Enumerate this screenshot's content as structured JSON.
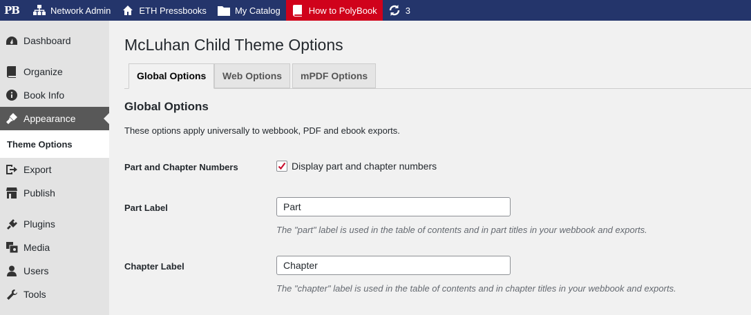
{
  "adminbar": {
    "logo": "PB",
    "items": [
      {
        "label": "Network Admin",
        "icon": "network-icon"
      },
      {
        "label": "ETH Pressbooks",
        "icon": "home-icon"
      },
      {
        "label": "My Catalog",
        "icon": "folder-icon"
      },
      {
        "label": "How to PolyBook",
        "icon": "book-icon"
      }
    ],
    "updates_count": "3",
    "colors": {
      "bar": "#24356b",
      "active": "#d0021b"
    }
  },
  "sidebar": {
    "items": [
      {
        "label": "Dashboard",
        "icon": "dashboard-icon"
      },
      {
        "label": "Organize",
        "icon": "book-icon"
      },
      {
        "label": "Book Info",
        "icon": "info-icon"
      },
      {
        "label": "Appearance",
        "icon": "brush-icon"
      },
      {
        "label": "Export",
        "icon": "export-icon"
      },
      {
        "label": "Publish",
        "icon": "store-icon"
      },
      {
        "label": "Plugins",
        "icon": "plug-icon"
      },
      {
        "label": "Media",
        "icon": "media-icon"
      },
      {
        "label": "Users",
        "icon": "user-icon"
      },
      {
        "label": "Tools",
        "icon": "wrench-icon"
      }
    ],
    "submenu": {
      "label": "Theme Options"
    }
  },
  "main": {
    "title": "McLuhan Child Theme Options",
    "tabs": [
      {
        "label": "Global Options"
      },
      {
        "label": "Web Options"
      },
      {
        "label": "mPDF Options"
      }
    ],
    "section_title": "Global Options",
    "section_desc": "These options apply universally to webbook, PDF and ebook exports.",
    "fields": {
      "numbers": {
        "label": "Part and Chapter Numbers",
        "checkbox_label": "Display part and chapter numbers",
        "checked": true
      },
      "part": {
        "label": "Part Label",
        "value": "Part",
        "help": "The \"part\" label is used in the table of contents and in part titles in your webbook and exports."
      },
      "chapter": {
        "label": "Chapter Label",
        "value": "Chapter",
        "help": "The \"chapter\" label is used in the table of contents and in chapter titles in your webbook and exports."
      }
    }
  }
}
